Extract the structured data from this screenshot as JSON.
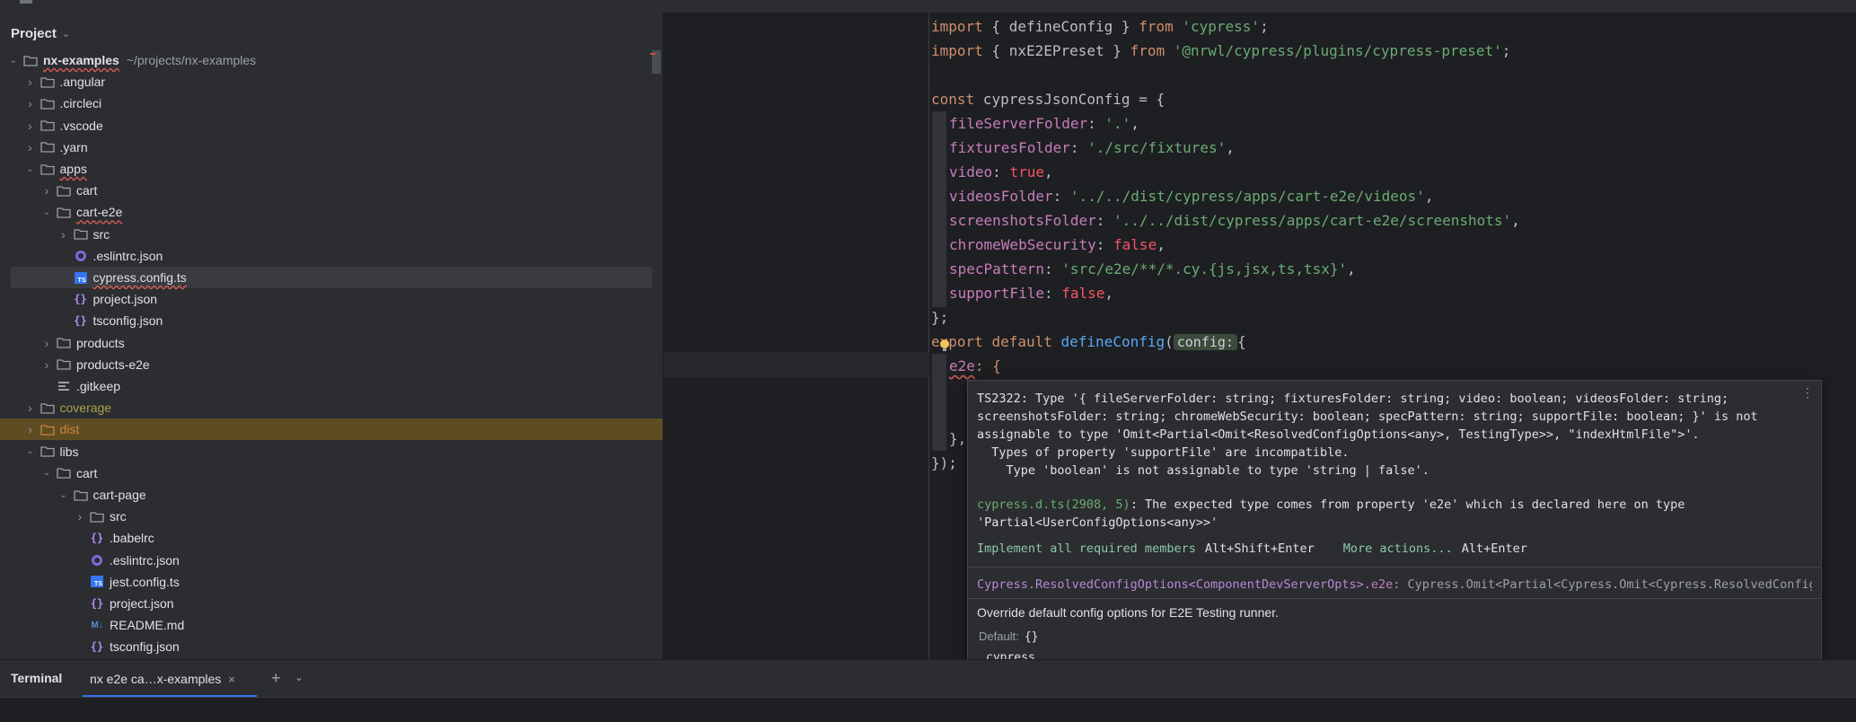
{
  "project": {
    "header": "Project",
    "root": {
      "name": "nx-examples",
      "path": "~/projects/nx-examples"
    },
    "items": [
      {
        "label": ".angular",
        "kind": "folder"
      },
      {
        "label": ".circleci",
        "kind": "folder"
      },
      {
        "label": ".vscode",
        "kind": "folder"
      },
      {
        "label": ".yarn",
        "kind": "folder"
      },
      {
        "label": "apps",
        "kind": "folder"
      },
      {
        "label": "cart",
        "kind": "folder"
      },
      {
        "label": "cart-e2e",
        "kind": "folder"
      },
      {
        "label": "src",
        "kind": "folder"
      },
      {
        "label": ".eslintrc.json",
        "kind": "eslint"
      },
      {
        "label": "cypress.config.ts",
        "kind": "ts"
      },
      {
        "label": "project.json",
        "kind": "json"
      },
      {
        "label": "tsconfig.json",
        "kind": "json"
      },
      {
        "label": "products",
        "kind": "folder"
      },
      {
        "label": "products-e2e",
        "kind": "folder"
      },
      {
        "label": ".gitkeep",
        "kind": "text"
      },
      {
        "label": "coverage",
        "kind": "folder"
      },
      {
        "label": "dist",
        "kind": "folder"
      },
      {
        "label": "libs",
        "kind": "folder"
      },
      {
        "label": "cart",
        "kind": "folder"
      },
      {
        "label": "cart-page",
        "kind": "folder"
      },
      {
        "label": "src",
        "kind": "folder"
      },
      {
        "label": ".babelrc",
        "kind": "json"
      },
      {
        "label": ".eslintrc.json",
        "kind": "eslint"
      },
      {
        "label": "jest.config.ts",
        "kind": "ts"
      },
      {
        "label": "project.json",
        "kind": "json"
      },
      {
        "label": "README.md",
        "kind": "md"
      },
      {
        "label": "tsconfig.json",
        "kind": "json"
      }
    ]
  },
  "editor": {
    "l1": {
      "a": "import",
      "b": " { defineConfig } ",
      "c": "from",
      "d": " ",
      "e": "'cypress'",
      "f": ";"
    },
    "l2": {
      "a": "import",
      "b": " { nxE2EPreset } ",
      "c": "from",
      "d": " ",
      "e": "'@nrwl/cypress/plugins/cypress-preset'",
      "f": ";"
    },
    "l4": {
      "a": "const",
      "b": " cypressJsonConfig = {"
    },
    "props": [
      {
        "key": "fileServerFolder",
        "value": "'.'",
        "type": "str"
      },
      {
        "key": "fixturesFolder",
        "value": "'./src/fixtures'",
        "type": "str"
      },
      {
        "key": "video",
        "value": "true",
        "type": "bool"
      },
      {
        "key": "videosFolder",
        "value": "'../../dist/cypress/apps/cart-e2e/videos'",
        "type": "str"
      },
      {
        "key": "screenshotsFolder",
        "value": "'../../dist/cypress/apps/cart-e2e/screenshots'",
        "type": "str"
      },
      {
        "key": "chromeWebSecurity",
        "value": "false",
        "type": "bool"
      },
      {
        "key": "specPattern",
        "value": "'src/e2e/**/*.cy.{js,jsx,ts,tsx}'",
        "type": "str"
      },
      {
        "key": "supportFile",
        "value": "false",
        "type": "bool"
      }
    ],
    "close_obj": "};",
    "export": {
      "a": "export",
      "b": "default",
      "c": "defineConfig",
      "hint": "config:",
      "d": "{"
    },
    "e2e": {
      "key": "e2e",
      "rest": ": {"
    },
    "close_inner": "},",
    "close_all": "});"
  },
  "popup": {
    "message": "TS2322: Type '{ fileServerFolder: string; fixturesFolder: string; video: boolean; videosFolder: string;\nscreenshotsFolder: string; chromeWebSecurity: boolean; specPattern: string; supportFile: boolean; }' is not\nassignable to type 'Omit<Partial<Omit<ResolvedConfigOptions<any>, TestingType>>, \"indexHtmlFile\">'.\n  Types of property 'supportFile' are incompatible.\n    Type 'boolean' is not assignable to type 'string | false'.",
    "source_file": "cypress.d.ts(2908, 5)",
    "source_text": ": The expected type comes from property 'e2e' which is declared here on type 'Partial<UserConfigOptions<any>>'",
    "action1": "Implement all required members",
    "action1_key": "Alt+Shift+Enter",
    "action2": "More actions...",
    "action2_key": "Alt+Enter",
    "decl_a": "Cypress.ResolvedConfigOptions<ComponentDevServerOpts>.",
    "decl_b": "e2e",
    "decl_c": ": Cypress.Omit<Partial<Cypress.Omit<Cypress.ResolvedConfigOpti",
    "description": "Override default config options for E2E Testing runner.",
    "default_label": "Default:",
    "default_value": "{}",
    "library": "cypress"
  },
  "terminal": {
    "title": "Terminal",
    "tab": "nx e2e ca…x-examples",
    "close": "×",
    "plus": "+",
    "chevron": "⌄"
  },
  "colors": {
    "accent": "#3574f0",
    "string": "#6aab73",
    "keyword": "#cf8e6d",
    "property": "#c77dbb",
    "error": "#cf5b56"
  }
}
